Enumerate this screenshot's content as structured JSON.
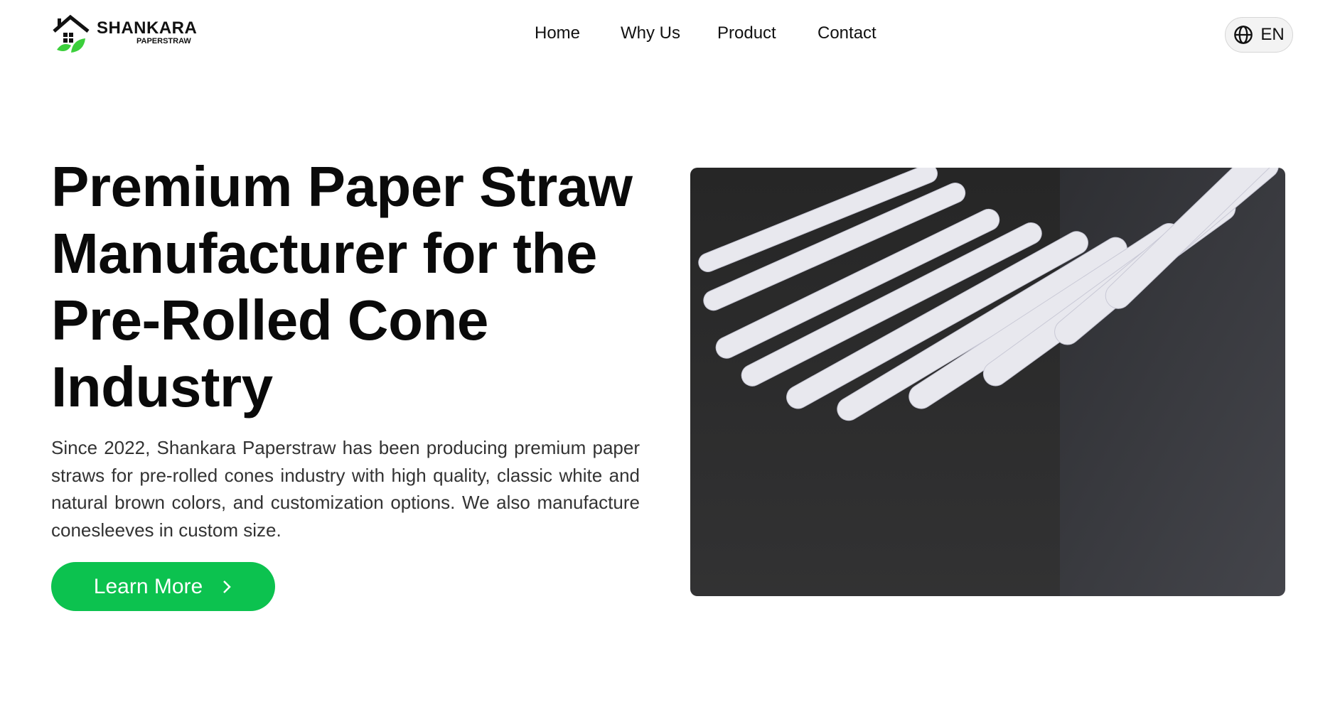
{
  "brand": {
    "name": "SHANKARA",
    "sub": "PAPERSTRAW"
  },
  "nav": {
    "items": [
      {
        "label": "Home"
      },
      {
        "label": "Why Us"
      },
      {
        "label": "Product"
      },
      {
        "label": "Contact"
      }
    ]
  },
  "language": {
    "label": "EN",
    "icon": "globe-icon"
  },
  "hero": {
    "title": "Premium Paper Straw Manufacturer for the Pre-Rolled Cone Industry",
    "description": "Since 2022, Shankara Paperstraw has been producing premium paper straws for pre-rolled cones industry with high quality, classic white and natural brown colors, and customization options. We also manufacture conesleeves in custom size.",
    "cta_label": "Learn More",
    "cta_icon": "chevron-right-icon"
  },
  "colors": {
    "accent": "#0cc24f",
    "leaf": "#3ccf3c"
  }
}
